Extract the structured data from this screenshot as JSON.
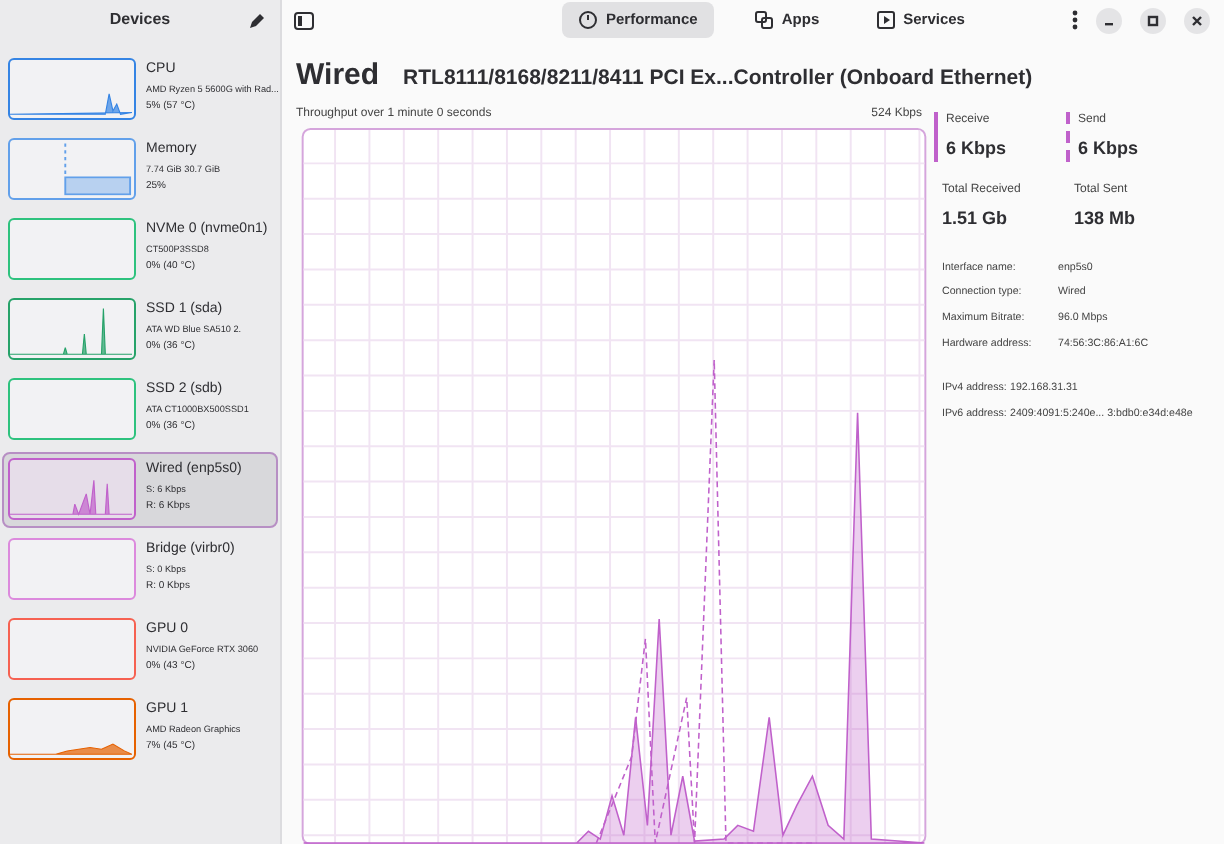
{
  "sidebar": {
    "title": "Devices",
    "items": [
      {
        "name": "CPU",
        "line1": "AMD Ryzen 5 5600G with Rad...",
        "line2": "5% (57 °C)",
        "color": "#3584e4",
        "selected": false
      },
      {
        "name": "Memory",
        "line1": "7.74 GiB 30.7 GiB",
        "line2": "25%",
        "color": "#62a0ea",
        "selected": false
      },
      {
        "name": "NVMe 0 (nvme0n1)",
        "line1": "CT500P3SSD8",
        "line2": "0% (40 °C)",
        "color": "#2ec27e",
        "selected": false
      },
      {
        "name": "SSD 1 (sda)",
        "line1": "ATA WD Blue SA510 2.",
        "line2": "0% (36 °C)",
        "color": "#26a269",
        "selected": false
      },
      {
        "name": "SSD 2 (sdb)",
        "line1": "ATA CT1000BX500SSD1",
        "line2": "0% (36 °C)",
        "color": "#2ec27e",
        "selected": false
      },
      {
        "name": "Wired (enp5s0)",
        "line1": "S: 6 Kbps",
        "line2": "R: 6 Kbps",
        "color": "#c061cb",
        "selected": true
      },
      {
        "name": "Bridge (virbr0)",
        "line1": "S: 0 Kbps",
        "line2": "R: 0 Kbps",
        "color": "#dc8add",
        "selected": false
      },
      {
        "name": "GPU 0",
        "line1": "NVIDIA GeForce RTX 3060",
        "line2": "0% (43 °C)",
        "color": "#f66151",
        "selected": false
      },
      {
        "name": "GPU 1",
        "line1": "AMD Radeon Graphics",
        "line2": "7% (45 °C)",
        "color": "#e66100",
        "selected": false
      }
    ]
  },
  "tabs": [
    {
      "label": "Performance",
      "selected": true
    },
    {
      "label": "Apps",
      "selected": false
    },
    {
      "label": "Services",
      "selected": false
    }
  ],
  "title": "Wired",
  "subtitle": "RTL8111/8168/8211/8411 PCI Ex...Controller (Onboard Ethernet)",
  "chart": {
    "caption": "Throughput over 1 minute 0 seconds",
    "max": "524 Kbps"
  },
  "stats": [
    {
      "label": "Receive",
      "value": "6 Kbps"
    },
    {
      "label": "Send",
      "value": "6 Kbps"
    },
    {
      "label": "Total Received",
      "value": "1.51 Gb"
    },
    {
      "label": "Total Sent",
      "value": "138 Mb"
    }
  ],
  "details": [
    {
      "label": "Interface name:",
      "value": "enp5s0"
    },
    {
      "label": "Connection type:",
      "value": "Wired"
    },
    {
      "label": "Maximum Bitrate:",
      "value": "96.0 Mbps"
    },
    {
      "label": "Hardware address:",
      "value": "74:56:3C:86:A1:6C"
    }
  ],
  "addresses": [
    {
      "label": "IPv4 address:",
      "value": "192.168.31.31"
    },
    {
      "label": "IPv6 address:",
      "value": "2409:4091:5:240e... 3:bdb0:e34d:e48e"
    }
  ]
}
